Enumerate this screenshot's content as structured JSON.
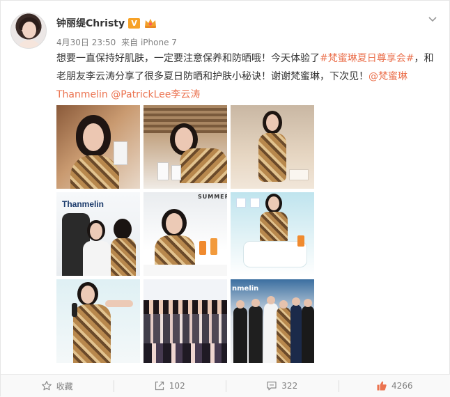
{
  "post": {
    "author": "钟丽缇Christy",
    "verified_badge": "V",
    "timestamp": "4月30日 23:50",
    "source": "来自 iPhone 7",
    "text_part1": "想要一直保持好肌肤，一定要注意保养和防晒哦！今天体验了",
    "hashtag": "#梵蜜琳夏日尊享会#",
    "text_part2": "，和老朋友李云涛分享了很多夏日防晒和护肤小秘诀！谢谢梵蜜琳，下次见！",
    "mention1": "@梵蜜琳Thanmelin",
    "mention2": "@PatrickLee李云涛",
    "photos": [
      {
        "alt": "selfie-with-product"
      },
      {
        "alt": "posing-with-products"
      },
      {
        "alt": "standing-pose"
      },
      {
        "alt": "event-stage-thanmelin",
        "sign_text": "Thanmelin"
      },
      {
        "alt": "sitting-with-drink",
        "sign_text": "SUMMER"
      },
      {
        "alt": "sitting-on-sofa"
      },
      {
        "alt": "speaking-microphone"
      },
      {
        "alt": "group-photo"
      },
      {
        "alt": "group-with-men",
        "sign_text": "nmelin"
      }
    ]
  },
  "actions": {
    "favorite_label": "收藏",
    "repost_count": "102",
    "comment_count": "322",
    "like_count": "4266"
  },
  "colors": {
    "link": "#eb7350",
    "like": "#eb7350",
    "muted": "#808080",
    "verified": "#f7a226"
  },
  "icons": [
    "star-icon",
    "repost-icon",
    "comment-icon",
    "thumbs-up-icon",
    "chevron-down-icon",
    "crown-icon"
  ]
}
